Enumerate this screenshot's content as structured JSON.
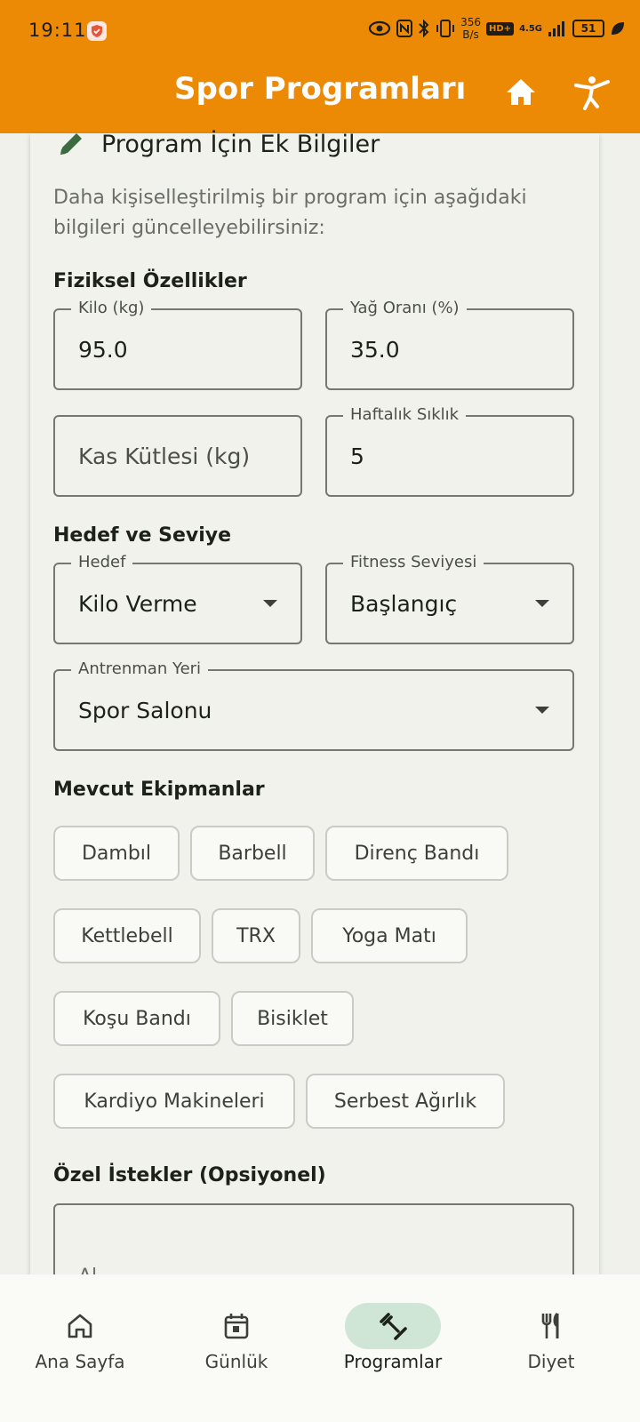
{
  "status": {
    "time": "19:11",
    "net_speed_value": "356",
    "net_speed_unit": "B/s",
    "hd_badge": "HD+",
    "network_type": "4.5G",
    "battery": "51"
  },
  "app": {
    "title": "Spor Programları",
    "header_color": "#ec8a05",
    "actions": [
      "home-icon",
      "fitness-icon"
    ]
  },
  "section": {
    "title": "Program İçin Ek Bilgiler",
    "description": "Daha kişiselleştirilmiş bir program için aşağıdaki bilgileri güncelleyebilirsiniz:"
  },
  "physical": {
    "heading": "Fiziksel Özellikler",
    "weight": {
      "label": "Kilo (kg)",
      "value": "95.0"
    },
    "fat": {
      "label": "Yağ Oranı (%)",
      "value": "35.0"
    },
    "muscle": {
      "placeholder": "Kas Kütlesi (kg)"
    },
    "frequency": {
      "label": "Haftalık Sıklık",
      "value": "5"
    }
  },
  "goal": {
    "heading": "Hedef ve Seviye",
    "target": {
      "label": "Hedef",
      "value": "Kilo Verme"
    },
    "level": {
      "label": "Fitness Seviyesi",
      "value": "Başlangıç"
    },
    "place": {
      "label": "Antrenman Yeri",
      "value": "Spor Salonu"
    }
  },
  "equipment": {
    "heading": "Mevcut Ekipmanlar",
    "items": [
      "Dambıl",
      "Barbell",
      "Direnç Bandı",
      "Kettlebell",
      "TRX",
      "Yoga Matı",
      "Koşu Bandı",
      "Bisiklet",
      "Kardiyo Makineleri",
      "Serbest Ağırlık"
    ]
  },
  "requests": {
    "heading": "Özel İstekler (Opsiyonel)",
    "hint": "Al..."
  },
  "nav": {
    "items": [
      {
        "label": "Ana Sayfa",
        "icon": "home-outline-icon"
      },
      {
        "label": "Günlük",
        "icon": "calendar-icon"
      },
      {
        "label": "Programlar",
        "icon": "dumbbell-icon"
      },
      {
        "label": "Diyet",
        "icon": "utensils-icon"
      }
    ],
    "active": "Programlar"
  }
}
